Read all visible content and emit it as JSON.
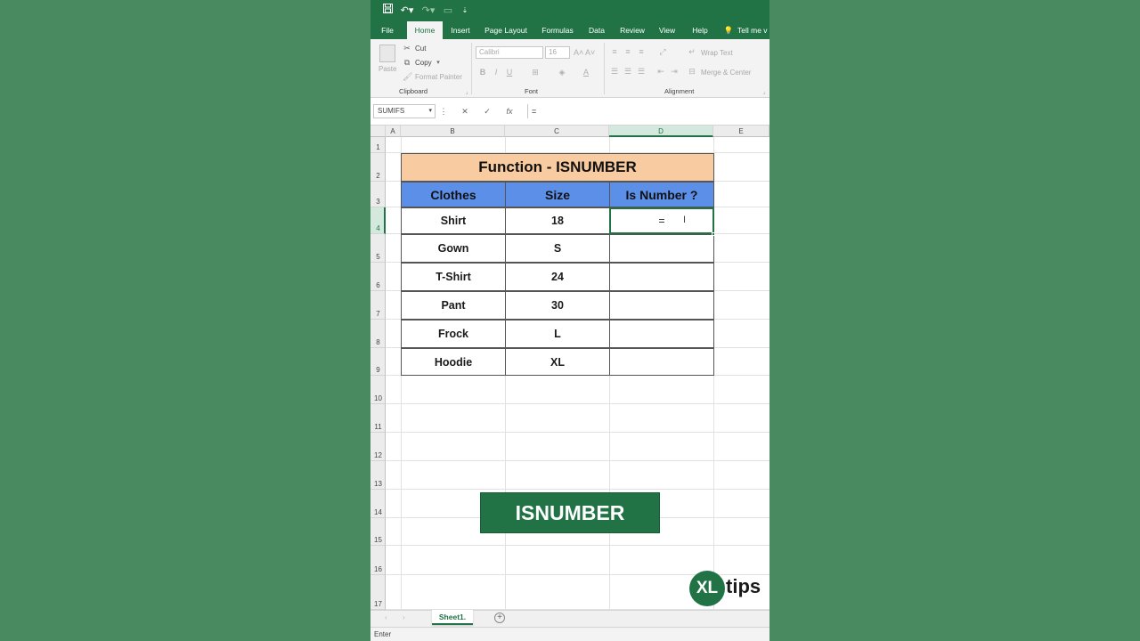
{
  "qat": {
    "save_icon": "save-icon",
    "undo_icon": "undo-icon",
    "redo_icon": "redo-icon"
  },
  "tabs": [
    "File",
    "Home",
    "Insert",
    "Page Layout",
    "Formulas",
    "Data",
    "Review",
    "View",
    "Help",
    "Tell me v"
  ],
  "ribbon": {
    "clipboard": {
      "paste": "Paste",
      "cut": "Cut",
      "copy": "Copy",
      "format_painter": "Format Painter",
      "label": "Clipboard"
    },
    "font": {
      "name": "Calibri",
      "size": "16",
      "label": "Font",
      "bold": "B",
      "italic": "I",
      "underline": "U"
    },
    "alignment": {
      "wrap_text": "Wrap Text",
      "merge_center": "Merge & Center",
      "label": "Alignment"
    }
  },
  "formula_bar": {
    "name_box": "SUMIFS",
    "fx": "fx",
    "value": "="
  },
  "columns": [
    "A",
    "B",
    "C",
    "D",
    "E"
  ],
  "rows": [
    "1",
    "2",
    "3",
    "4",
    "5",
    "6",
    "7",
    "8",
    "9",
    "10",
    "11",
    "12",
    "13",
    "14",
    "15",
    "16",
    "17"
  ],
  "table": {
    "title": "Function - ISNUMBER",
    "headers": [
      "Clothes",
      "Size",
      "Is Number ?"
    ],
    "rows": [
      {
        "clothes": "Shirt",
        "size": "18",
        "is_number": "="
      },
      {
        "clothes": "Gown",
        "size": "S",
        "is_number": ""
      },
      {
        "clothes": "T-Shirt",
        "size": "24",
        "is_number": ""
      },
      {
        "clothes": "Pant",
        "size": "30",
        "is_number": ""
      },
      {
        "clothes": "Frock",
        "size": "L",
        "is_number": ""
      },
      {
        "clothes": "Hoodie",
        "size": "XL",
        "is_number": ""
      }
    ]
  },
  "banner": "ISNUMBER",
  "logo": {
    "xl": "XL",
    "tips": "tips"
  },
  "sheet_tab": "Sheet1.",
  "status": "Enter",
  "colors": {
    "excel_green": "#217346",
    "title_fill": "#f8cba0",
    "header_fill": "#5b8fe8",
    "background": "#4a8a60"
  }
}
